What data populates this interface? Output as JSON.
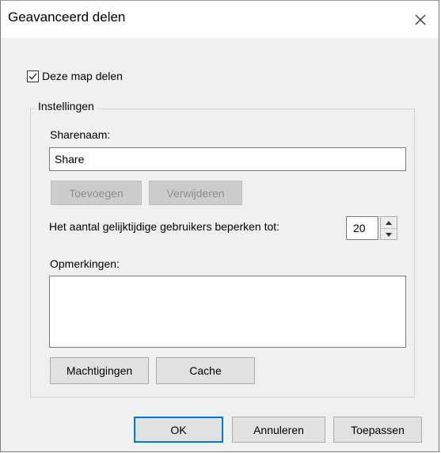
{
  "dialog": {
    "title": "Geavanceerd delen"
  },
  "share_checkbox": {
    "label": "Deze map delen",
    "checked": true
  },
  "settings": {
    "legend": "Instellingen",
    "share_name_label": "Sharenaam:",
    "share_name_value": "Share",
    "add_button": "Toevoegen",
    "remove_button": "Verwijderen",
    "limit_label": "Het aantal gelijktijdige gebruikers beperken tot:",
    "limit_value": "20",
    "comments_label": "Opmerkingen:",
    "comments_value": "",
    "permissions_button": "Machtigingen",
    "cache_button": "Cache"
  },
  "footer": {
    "ok": "OK",
    "cancel": "Annuleren",
    "apply": "Toepassen"
  },
  "icons": {
    "close": "close-icon",
    "check": "checkmark-icon",
    "up": "arrow-up-icon",
    "down": "arrow-down-icon"
  }
}
